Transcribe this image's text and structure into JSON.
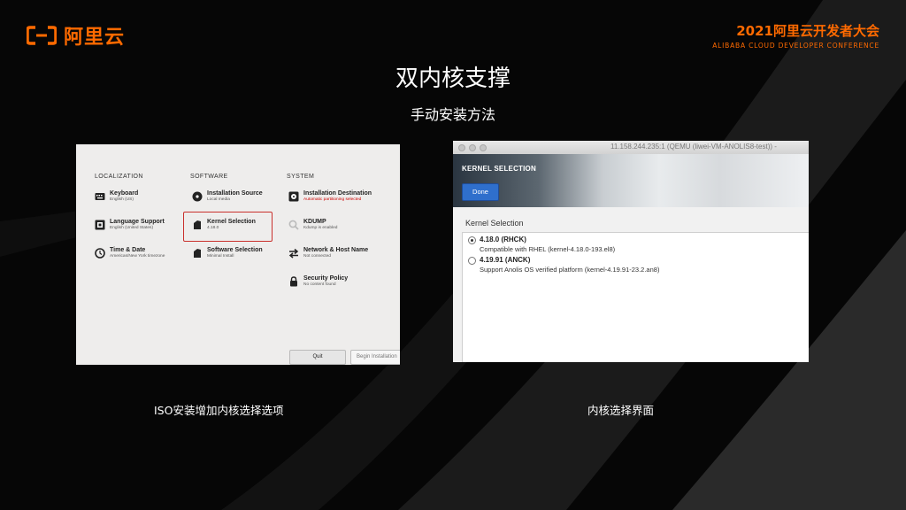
{
  "brand": {
    "logo_text": "阿里云",
    "conference_title": "2021阿里云开发者大会",
    "conference_subtitle": "ALIBABA CLOUD DEVELOPER CONFERENCE",
    "accent_color": "#ff6a00"
  },
  "slide": {
    "title": "双内核支撑",
    "subtitle": "手动安装方法"
  },
  "left_screenshot": {
    "columns": [
      "LOCALIZATION",
      "SOFTWARE",
      "SYSTEM"
    ],
    "items": [
      {
        "title": "Keyboard",
        "sub": "English (US)",
        "icon": "keyboard-icon"
      },
      {
        "title": "Language Support",
        "sub": "English (United States)",
        "icon": "language-icon"
      },
      {
        "title": "Time & Date",
        "sub": "Americas/New York timezone",
        "icon": "clock-icon"
      },
      {
        "title": "Installation Source",
        "sub": "Local media",
        "icon": "disc-icon"
      },
      {
        "title": "Kernel Selection",
        "sub": "4.18.0",
        "icon": "package-icon"
      },
      {
        "title": "Software Selection",
        "sub": "Minimal Install",
        "icon": "package-icon"
      },
      {
        "title": "Installation Destination",
        "sub": "Automatic partitioning selected",
        "icon": "disk-icon"
      },
      {
        "title": "KDUMP",
        "sub": "Kdump is enabled",
        "icon": "search-icon"
      },
      {
        "title": "Network & Host Name",
        "sub": "Not connected",
        "icon": "network-arrows-icon"
      },
      {
        "title": "Security Policy",
        "sub": "No content found",
        "icon": "lock-icon"
      }
    ],
    "quit_label": "Quit",
    "begin_label": "Begin Installation",
    "highlight_color": "#c9302c",
    "warning_color": "#cc0000"
  },
  "right_screenshot": {
    "window_title": "11.158.244.235:1 (QEMU (liwei-VM-ANOLIS8-test)) -",
    "header_title": "KERNEL SELECTION",
    "done_label": "Done",
    "panel_label": "Kernel Selection",
    "options": [
      {
        "name": "4.18.0 (RHCK)",
        "desc": "Compatible with RHEL (kernel-4.18.0-193.el8)",
        "selected": true
      },
      {
        "name": "4.19.91 (ANCK)",
        "desc": "Support Anolis OS verified platform (kernel-4.19.91-23.2.an8)",
        "selected": false
      }
    ],
    "done_color": "#2f6fcc"
  },
  "captions": {
    "left": "ISO安装增加内核选择选项",
    "right": "内核选择界面"
  }
}
